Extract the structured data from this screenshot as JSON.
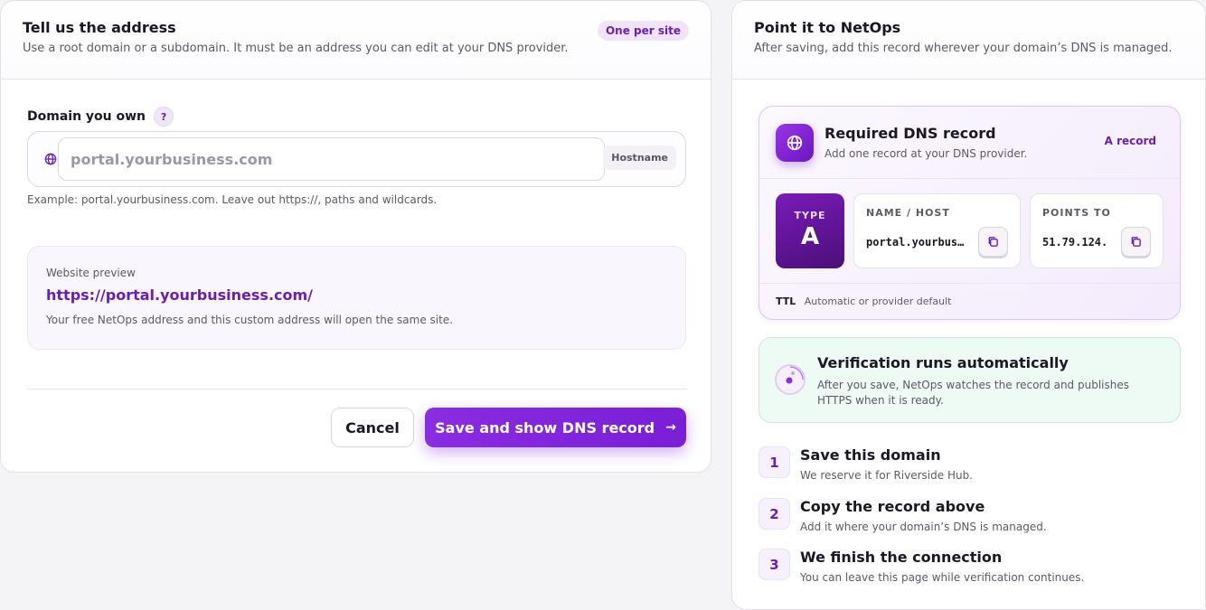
{
  "left": {
    "title": "Tell us the address",
    "subtitle": "Use a root domain or a subdomain. It must be an address you can edit at your DNS provider.",
    "pill": "One per site",
    "field_label": "Domain you own",
    "help": "?",
    "input_placeholder": "portal.yourbusiness.com",
    "input_value": "",
    "suffix": "Hostname",
    "hint": "Example: portal.yourbusiness.com. Leave out https://, paths and wildcards.",
    "preview": {
      "label": "Website preview",
      "url": "https://portal.yourbusiness.com/",
      "note": "Your free NetOps address and this custom address will open the same site."
    },
    "cancel_label": "Cancel",
    "save_label": "Save and show DNS record",
    "save_arrow": "→"
  },
  "right": {
    "title": "Point it to NetOps",
    "subtitle": "After saving, add this record wherever your domain’s DNS is managed.",
    "dns": {
      "title": "Required DNS record",
      "subtitle": "Add one record at your DNS provider.",
      "tag": "A record",
      "type_label": "TYPE",
      "type_value": "A",
      "name_label": "NAME / HOST",
      "name_value": "portal.yourbusiness.com",
      "points_label": "POINTS TO",
      "points_value": "51.79.124.",
      "ttl_key": "TTL",
      "ttl_value": "Automatic or provider default"
    },
    "verify": {
      "title": "Verification runs automatically",
      "text": "After you save, NetOps watches the record and publishes HTTPS when it is ready."
    },
    "steps": [
      {
        "num": "1",
        "title": "Save this domain",
        "desc": "We reserve it for Riverside Hub."
      },
      {
        "num": "2",
        "title": "Copy the record above",
        "desc": "Add it where your domain’s DNS is managed."
      },
      {
        "num": "3",
        "title": "We finish the connection",
        "desc": "You can leave this page while verification continues."
      }
    ]
  },
  "colors": {
    "accent": "#7a1fd6",
    "accent_text": "#6a1fb0",
    "success_bg": "#eefaf4"
  },
  "icons": {
    "input": "globe-icon",
    "dns": "globe-icon",
    "copy": "copy-icon",
    "verify": "spinner-icon"
  }
}
